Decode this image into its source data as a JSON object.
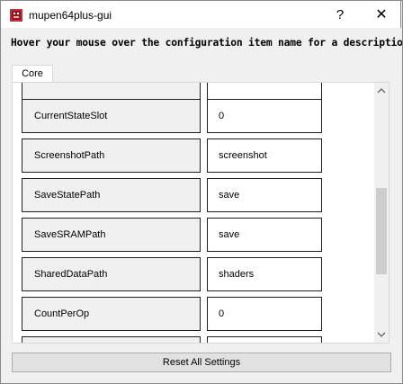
{
  "window": {
    "title": "mupen64plus-gui",
    "help_label": "?",
    "close_label": "✕"
  },
  "instructions": "Hover your mouse over the configuration item name for a description.",
  "tabs": [
    {
      "label": "Core"
    }
  ],
  "settings": [
    {
      "name": "",
      "value": ""
    },
    {
      "name": "CurrentStateSlot",
      "value": "0"
    },
    {
      "name": "ScreenshotPath",
      "value": "screenshot"
    },
    {
      "name": "SaveStatePath",
      "value": "save"
    },
    {
      "name": "SaveSRAMPath",
      "value": "save"
    },
    {
      "name": "SharedDataPath",
      "value": "shaders"
    },
    {
      "name": "CountPerOp",
      "value": "0"
    },
    {
      "name": "",
      "value": ""
    }
  ],
  "scrollbar": {
    "up_icon": "chevron-up-icon",
    "down_icon": "chevron-down-icon"
  },
  "reset_button": "Reset All Settings"
}
